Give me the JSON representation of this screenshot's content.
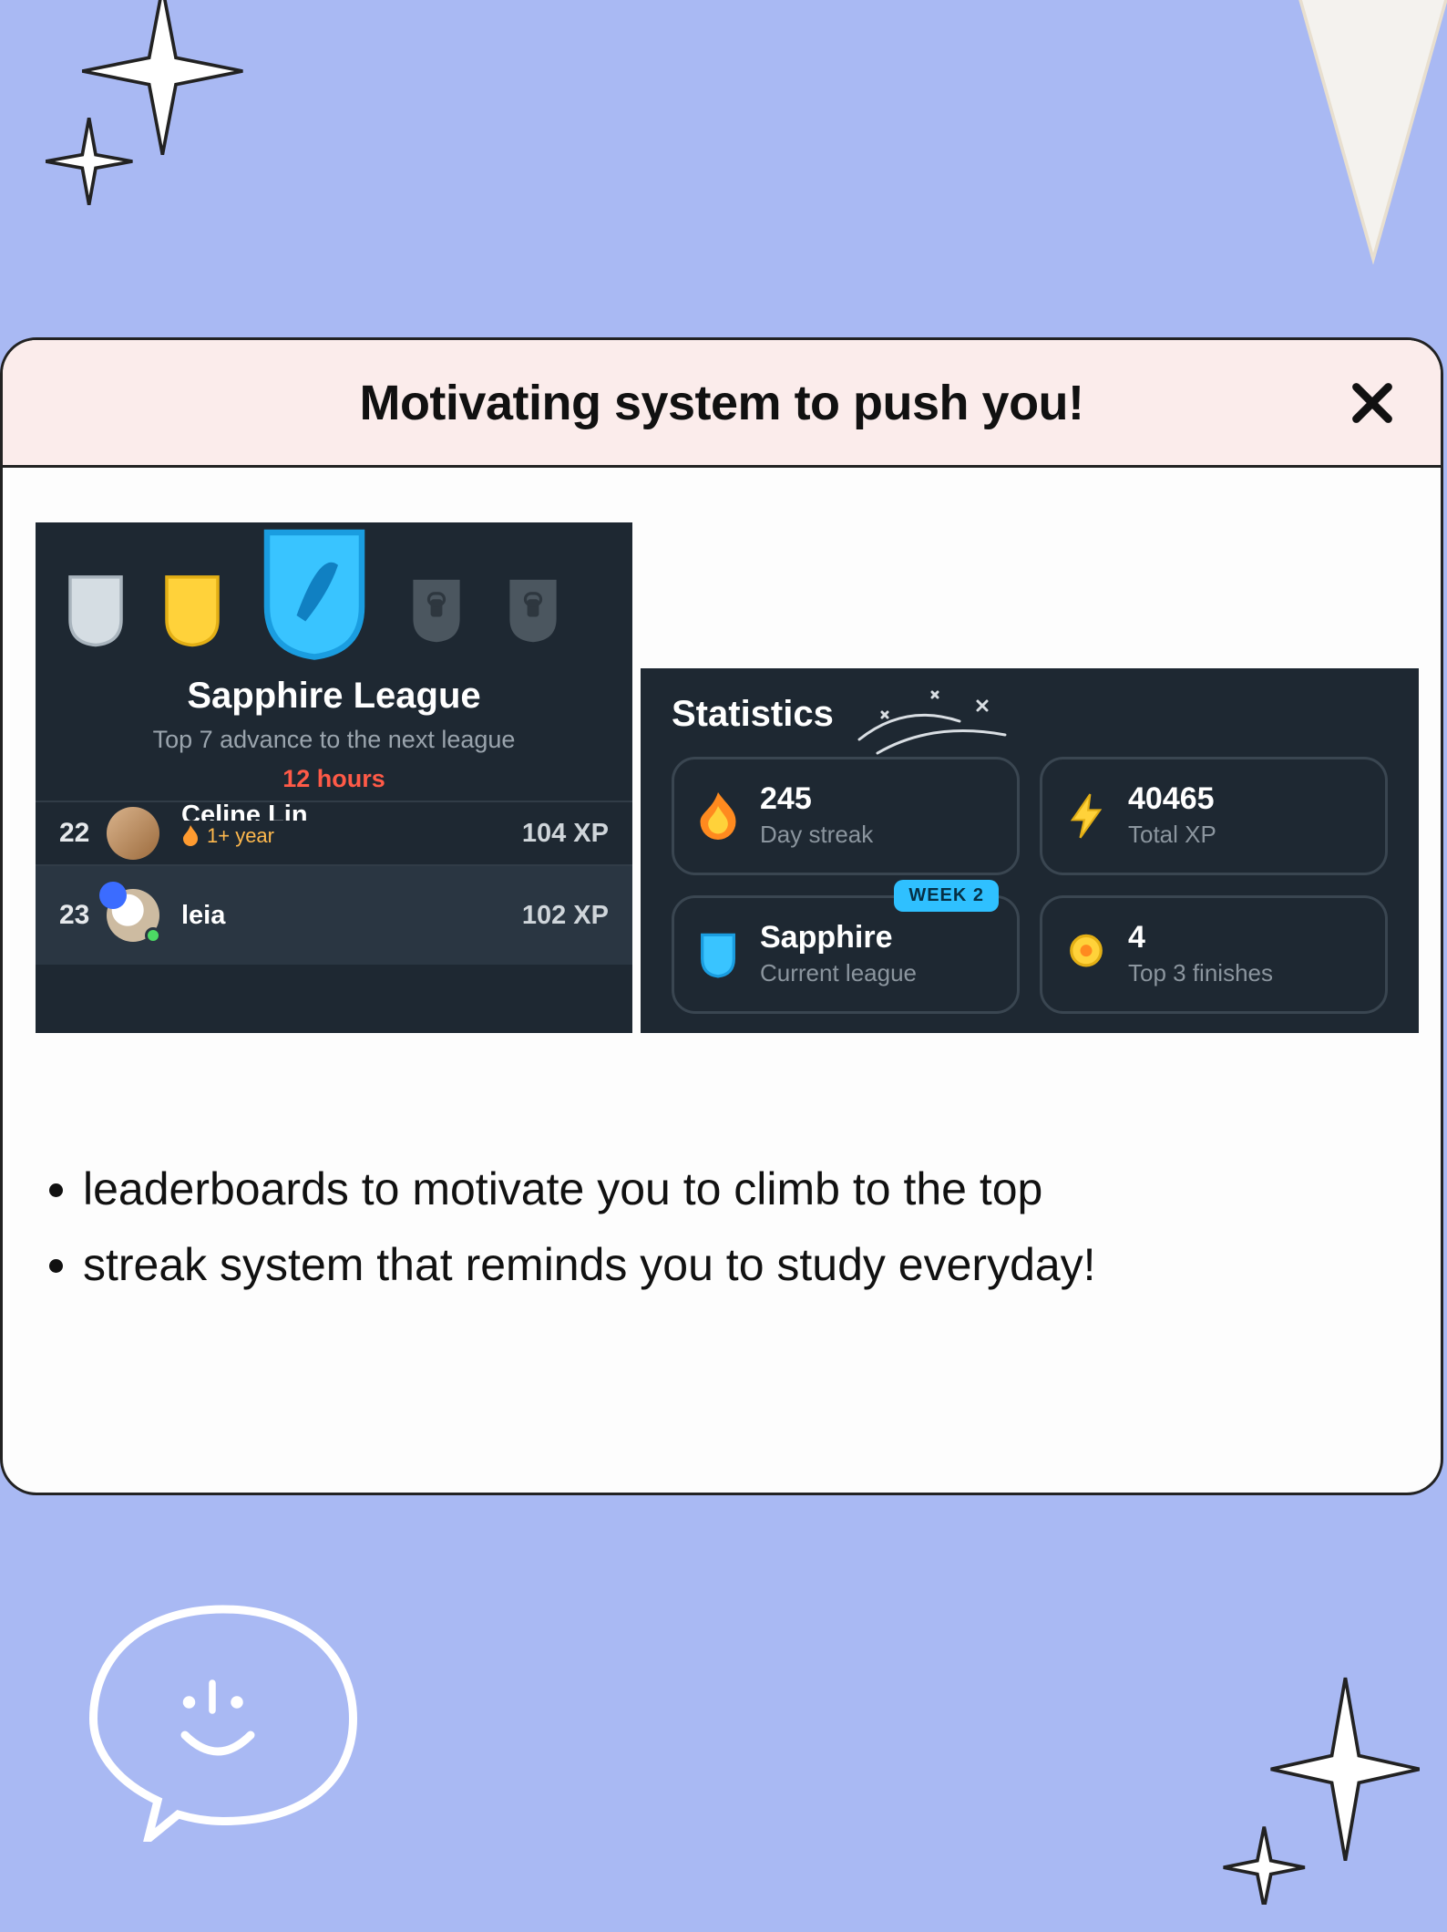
{
  "header": {
    "title": "Motivating system to push you!"
  },
  "leaderboard": {
    "league_name": "Sapphire League",
    "advance_text": "Top 7 advance to the next league",
    "time_left": "12 hours",
    "rows": [
      {
        "rank": "22",
        "name": "Celine Lin",
        "streak_badge": "1+ year",
        "xp": "104 XP"
      },
      {
        "rank": "23",
        "name": "leia",
        "xp": "102 XP"
      }
    ]
  },
  "statistics": {
    "title": "Statistics",
    "week_pill": "WEEK 2",
    "items": {
      "streak": {
        "value": "245",
        "label": "Day streak"
      },
      "xp": {
        "value": "40465",
        "label": "Total XP"
      },
      "league": {
        "value": "Sapphire",
        "label": "Current league"
      },
      "finishes": {
        "value": "4",
        "label": "Top 3 finishes"
      }
    }
  },
  "bullets": [
    "leaderboards to motivate you to climb to the top",
    "streak system that reminds you to study everyday!"
  ],
  "colors": {
    "bg": "#a9b9f3",
    "panel": "#1e2832",
    "accent_red": "#ff5a47",
    "accent_blue": "#2fc0ff"
  }
}
